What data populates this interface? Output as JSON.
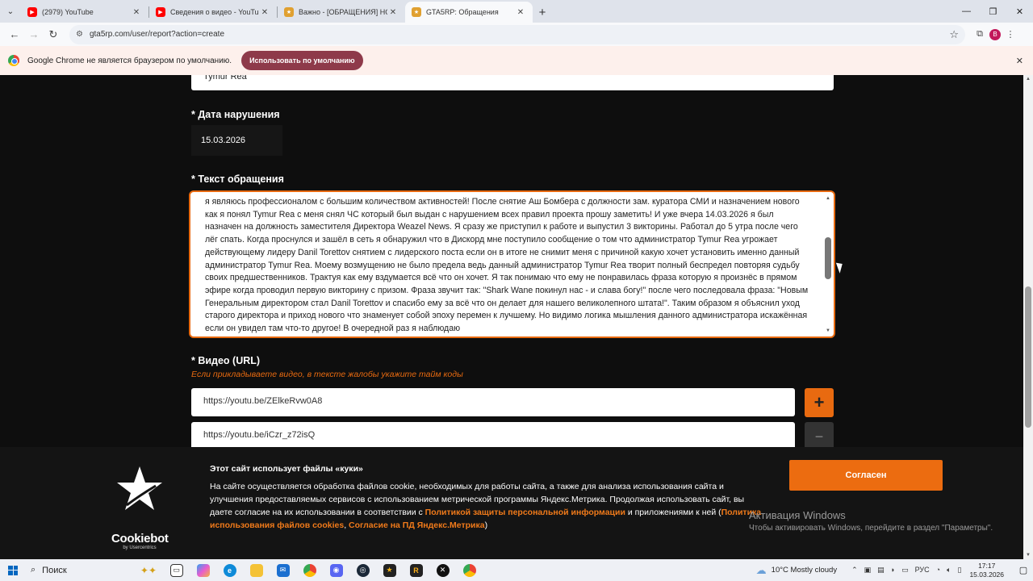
{
  "browser": {
    "tabs": [
      {
        "title": "(2979) YouTube",
        "color": "#ff0000",
        "active": false
      },
      {
        "title": "Сведения о видео - YouTube S",
        "color": "#ff0000",
        "active": false
      },
      {
        "title": "Важно - [ОБРАЩЕНИЯ] НОВЫ",
        "color": "#e0a030",
        "active": false
      },
      {
        "title": "GTA5RP: Обращения",
        "color": "#e0a030",
        "active": true
      }
    ],
    "url": "gta5rp.com/user/report?action=create",
    "profile_initial": "B",
    "infobar_text": "Google Chrome не является браузером по умолчанию.",
    "infobar_button": "Использовать по умолчанию"
  },
  "form": {
    "top_field_value": "Tymur Rea",
    "date_label": "* Дата нарушения",
    "date_value": "15.03.2026",
    "text_label": "* Текст обращения",
    "text_value": "я являюсь профессионалом с большим количеством активностей! После снятие Аш Бомбера с должности зам. куратора СМИ и назначением нового как я понял Tymur Rea с меня снял ЧС который был выдан с нарушением всех правил проекта прошу заметить! И уже вчера 14.03.2026 я был назначен на должность заместителя Директора Weazel News. Я сразу же приступил к работе и выпустил 3 викторины. Работал до 5 утра после чего лёг спать. Когда проснулся и зашёл в сеть я обнаружил что в Дискорд мне поступило сообщение о том что администратор Tymur Rea угрожает действующему лидеру Danil Torettov снятием с лидерского поста если он в итоге не снимит меня с причиной какую хочет установить именно данный администратор Tymur Rea. Моему возмущению не было предела ведь данный администратор Tymur Rea творит полный беспредел повторяя судьбу своих предшественников. Трактуя как ему вздумается всё что он хочет. Я так понимаю что ему не понравилась фраза которую я произнёс в прямом эфире когда проводил первую викторину с призом. Фраза звучит так: \"Shark Wane покинул нас - и слава богу!\" после чего последовала фраза: \"Новым Генеральным директором стал Danil Torettov и спасибо ему за всё что он делает для нашего великолепного штата!\". Таким образом я объяснил уход старого директора и приход нового что знаменует собой эпоху перемен к лучшему. Но видимо логика мышления данного администратора искажённая если он увидел там что-то другое! В очередной раз я наблюдаю",
    "video_label": "* Видео (URL)",
    "video_hint": "Если прикладываете видео, в тексте жалобы укажите тайм коды",
    "video_urls": [
      "https://youtu.be/ZElkeRvw0A8",
      "https://youtu.be/iCzr_z72isQ"
    ],
    "add_symbol": "+",
    "remove_symbol": "−"
  },
  "cookie": {
    "brand": "Cookiebot",
    "brand_sub": "by Usercentrics",
    "title": "Этот сайт использует файлы «куки»",
    "text_part1": "На сайте осуществляется обработка файлов cookie, необходимых для работы сайта, а также для анализа использования сайта и улучшения предоставляемых сервисов с использованием метрической программы Яндекс.Метрика. Продолжая использовать сайт, вы даете согласие на их использовании в соответствии с ",
    "link1": "Политикой защиты персональной информации",
    "text_part2": " и приложениями к ней (",
    "link2": "Политика использования  файлов cookies",
    "text_part3": ", ",
    "link3": "Согласие на ПД Яндекс.Метрика",
    "text_part4": ")",
    "accept": "Согласен"
  },
  "windows": {
    "activate_title": "Активация Windows",
    "activate_text": "Чтобы активировать Windows, перейдите в раздел \"Параметры\".",
    "search": "Поиск",
    "weather": "10°C  Mostly cloudy",
    "lang": "РУС",
    "time": "17:17",
    "date": "15.03.2026"
  },
  "colors": {
    "accent": "#e86a10",
    "page_bg": "#0e0e0e"
  }
}
